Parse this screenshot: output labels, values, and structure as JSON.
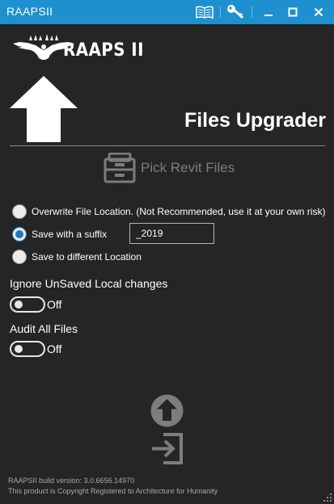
{
  "window": {
    "title": "RAAPSII",
    "controls": [
      "book-icon",
      "key-icon",
      "minimize-icon",
      "maximize-icon",
      "close-icon"
    ]
  },
  "brand": {
    "logo_text": "RAAPS II",
    "logo_icon": "eagle-logo"
  },
  "page": {
    "heading": "Files Upgrader",
    "heading_icon": "upload-arrow-icon"
  },
  "pick": {
    "label": "Pick Revit Files",
    "icon": "file-cabinet-icon"
  },
  "options": {
    "overwrite_label": "Overwrite File Location. (Not Recommended, use it at your own risk)",
    "suffix_label": "Save with a suffix",
    "suffix_value": "_2019",
    "different_location_label": "Save to different Location",
    "selected": "suffix"
  },
  "settings": {
    "ignore_label": "Ignore UnSaved Local changes",
    "ignore_state": "Off",
    "audit_label": "Audit All Files",
    "audit_state": "Off"
  },
  "actions": {
    "upgrade_icon": "circle-arrow-up-icon",
    "export_icon": "sign-in-icon"
  },
  "footer": {
    "build": "RAAPSII build version: 3.0.6656.14970",
    "copyright": "This product is Copyright Registered to Architecture for Humanity"
  },
  "colors": {
    "accent": "#1e90d0",
    "background": "#252525",
    "muted": "#7d7d7d"
  }
}
